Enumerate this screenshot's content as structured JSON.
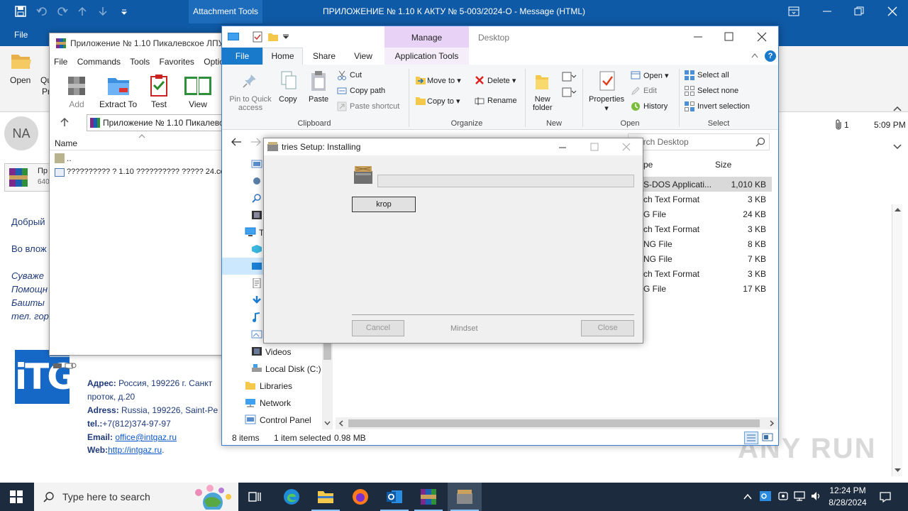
{
  "outlook": {
    "title": "ПРИЛОЖЕНИЕ № 1.10 К АКТУ № 5-003/2024-О  -  Message (HTML)",
    "context_tab": "Attachment Tools",
    "menu_file": "File",
    "ribbon_open": "Open",
    "ribbon_qu": "Qu",
    "ribbon_pr": "Pr",
    "sender_initials": "NA",
    "attach_name": "Пр",
    "attach_size": "640",
    "attach_count": "1",
    "time": "5:09 PM",
    "body_lines": [
      "Добрый",
      "Во влож",
      "Сувaже",
      "Помощн",
      "Башты",
      "тел. гор"
    ],
    "address_label": "Адрес:",
    "address_value": "Россия, 199226  г. Санкт",
    "address_value2": "проток, д.20",
    "adress_label": "Adress:",
    "adress_value": "Russia, 199226,  Saint-Pe",
    "tel_label": "tel.:",
    "tel_value": "+7(812)374-97-97",
    "email_label": "Email:",
    "email_value": "office@intgaz.ru",
    "web_label": "Web:",
    "web_value": "http://intgaz.ru",
    "web_suffix": ".",
    "logo_text": "iTG"
  },
  "winrar": {
    "title": "Приложение № 1.10 Пикалевское ЛПУ",
    "menu": [
      "File",
      "Commands",
      "Tools",
      "Favorites",
      "Optio"
    ],
    "toolbar": [
      "Add",
      "Extract To",
      "Test",
      "View"
    ],
    "path": "Приложение № 1.10 Пикалевс",
    "col_name": "Name",
    "rows": [
      "..",
      "?????????? ? 1.10 ?????????? ????? 24.com"
    ]
  },
  "explorer": {
    "manage_tab": "Manage",
    "location": "Desktop",
    "tabs": [
      "File",
      "Home",
      "Share",
      "View",
      "Application Tools"
    ],
    "clipboard": {
      "pin": "Pin to Quick",
      "pin2": "access",
      "copy": "Copy",
      "paste": "Paste",
      "cut": "Cut",
      "copy_path": "Copy path",
      "paste_shortcut": "Paste shortcut",
      "label": "Clipboard"
    },
    "organize": {
      "move_to": "Move to",
      "copy_to": "Copy to",
      "delete": "Delete",
      "rename": "Rename",
      "label": "Organize"
    },
    "new": {
      "new_folder": "New",
      "new_folder2": "folder",
      "label": "New"
    },
    "open": {
      "properties": "Properties",
      "open": "Open",
      "edit": "Edit",
      "history": "History",
      "label": "Open"
    },
    "select": {
      "all": "Select all",
      "none": "Select none",
      "invert": "Invert selection",
      "label": "Select"
    },
    "search_placeholder": "arch Desktop",
    "col_type": "pe",
    "col_size": "Size",
    "nav": [
      "T",
      "Videos",
      "Local Disk (C:)",
      "Libraries",
      "Network",
      "Control Panel"
    ],
    "files": [
      {
        "type": "S-DOS Applicati...",
        "size": "1,010 KB"
      },
      {
        "type": "ch Text Format",
        "size": "3 KB"
      },
      {
        "type": "G File",
        "size": "24 KB"
      },
      {
        "type": "ch Text Format",
        "size": "3 KB"
      },
      {
        "type": "NG File",
        "size": "8 KB"
      },
      {
        "type": "NG File",
        "size": "7 KB"
      },
      {
        "type": "ch Text Format",
        "size": "3 KB"
      },
      {
        "type": "G File",
        "size": "17 KB"
      }
    ],
    "status_items": "8 items",
    "status_selected": "1 item selected",
    "status_size": "0.98 MB"
  },
  "setup": {
    "title": "tries Setup: Installing",
    "button_main": "krop",
    "cancel": "Cancel",
    "brand": "Mindset",
    "close": "Close",
    "progress": 0
  },
  "taskbar": {
    "search_placeholder": "Type here to search",
    "time": "12:24 PM",
    "date": "8/28/2024"
  },
  "watermark": "ANY RUN",
  "colors": {
    "outlook_blue": "#0f5aa6",
    "manage_tab": "#e8d2f5",
    "taskbar": "#1c2b3d",
    "ribbon_bg": "#f3f3f3"
  }
}
